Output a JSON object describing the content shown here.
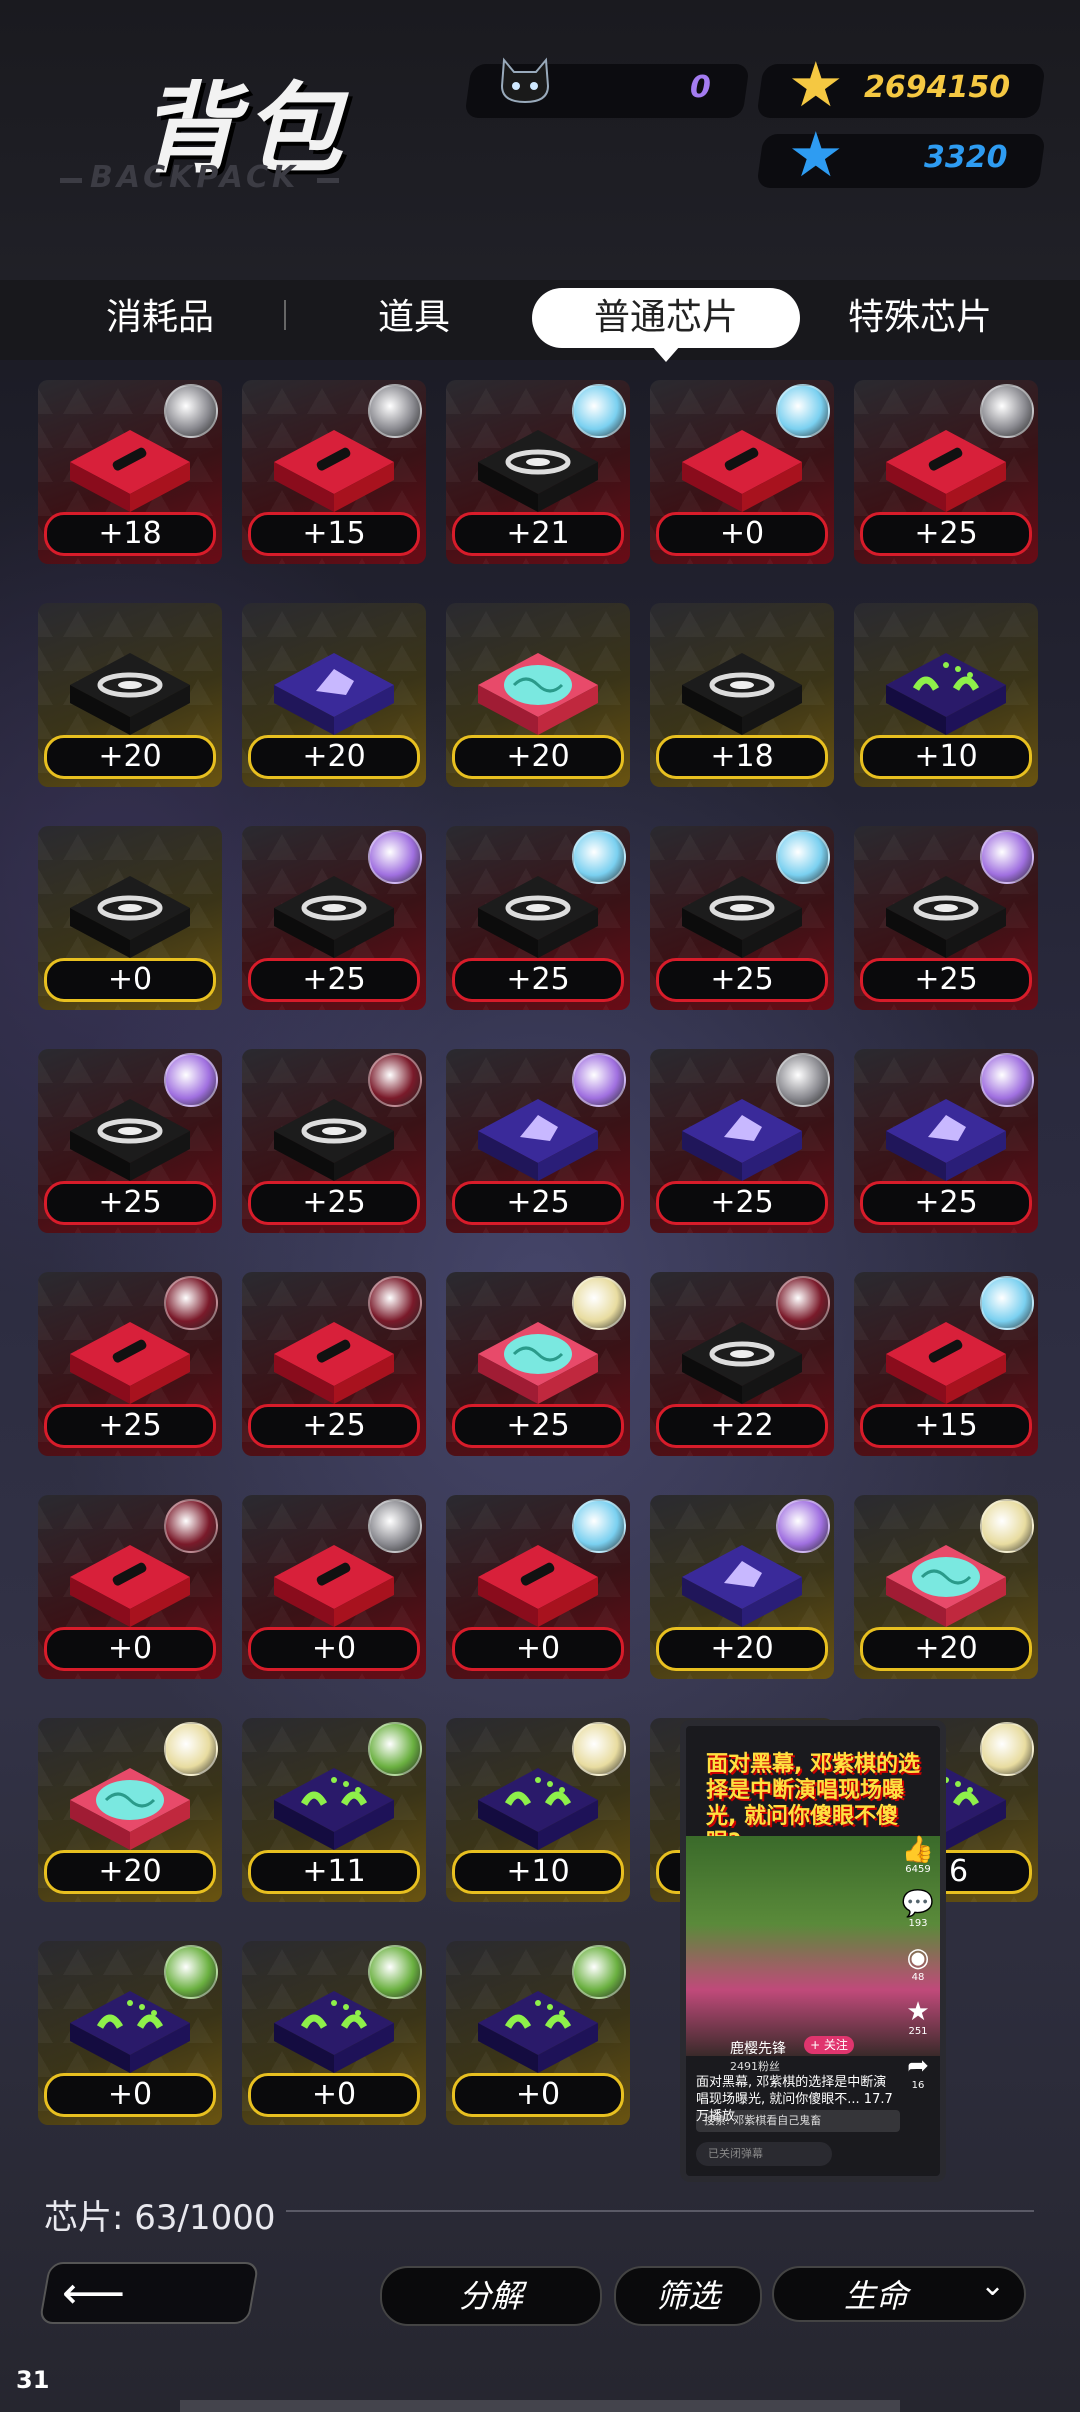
{
  "header": {
    "title": "背包",
    "subtitle": "BACKPACK",
    "currencies": [
      {
        "name": "cat-token",
        "value": "0",
        "color": "#a47cf0"
      },
      {
        "name": "gold-star",
        "value": "2694150",
        "color": "#f5c842"
      },
      {
        "name": "blue-star",
        "value": "3320",
        "color": "#2e9cf2"
      }
    ]
  },
  "tabs": [
    {
      "label": "消耗品",
      "active": false
    },
    {
      "label": "道具",
      "active": false
    },
    {
      "label": "普通芯片",
      "active": true
    },
    {
      "label": "特殊芯片",
      "active": false
    }
  ],
  "chips": [
    {
      "value": "+18",
      "frame": "red",
      "icon": "bullet-icon",
      "badge": "mecha-badge"
    },
    {
      "value": "+15",
      "frame": "red",
      "icon": "bullet-icon",
      "badge": "mecha-badge"
    },
    {
      "value": "+21",
      "frame": "red",
      "icon": "vortex-icon",
      "badge": "ice-badge"
    },
    {
      "value": "+0",
      "frame": "red",
      "icon": "bullet-icon",
      "badge": "ice-badge"
    },
    {
      "value": "+25",
      "frame": "red",
      "icon": "bullet-icon",
      "badge": "mecha-badge"
    },
    {
      "value": "+20",
      "frame": "gold",
      "icon": "vortex-icon",
      "badge": ""
    },
    {
      "value": "+20",
      "frame": "gold",
      "icon": "crest-icon",
      "badge": ""
    },
    {
      "value": "+20",
      "frame": "gold",
      "icon": "brain-icon",
      "badge": ""
    },
    {
      "value": "+18",
      "frame": "gold",
      "icon": "vortex-icon",
      "badge": ""
    },
    {
      "value": "+10",
      "frame": "gold",
      "icon": "wave-icon",
      "badge": ""
    },
    {
      "value": "+0",
      "frame": "gold",
      "icon": "vortex-icon",
      "badge": ""
    },
    {
      "value": "+25",
      "frame": "red",
      "icon": "vortex-icon",
      "badge": "purple-badge"
    },
    {
      "value": "+25",
      "frame": "red",
      "icon": "vortex-icon",
      "badge": "ice-badge"
    },
    {
      "value": "+25",
      "frame": "red",
      "icon": "vortex-icon",
      "badge": "ice-badge"
    },
    {
      "value": "+25",
      "frame": "red",
      "icon": "vortex-icon",
      "badge": "purple-badge"
    },
    {
      "value": "+25",
      "frame": "red",
      "icon": "vortex-icon",
      "badge": "purple-badge"
    },
    {
      "value": "+25",
      "frame": "red",
      "icon": "vortex-icon",
      "badge": "crimson-badge"
    },
    {
      "value": "+25",
      "frame": "red",
      "icon": "crest-icon",
      "badge": "purple-badge"
    },
    {
      "value": "+25",
      "frame": "red",
      "icon": "crest-icon",
      "badge": "mecha-badge"
    },
    {
      "value": "+25",
      "frame": "red",
      "icon": "crest-icon",
      "badge": "purple-badge"
    },
    {
      "value": "+25",
      "frame": "red",
      "icon": "bullet-icon",
      "badge": "crimson-badge"
    },
    {
      "value": "+25",
      "frame": "red",
      "icon": "bullet-icon",
      "badge": "crimson-badge"
    },
    {
      "value": "+25",
      "frame": "red",
      "icon": "brain-icon",
      "badge": "blonde-badge"
    },
    {
      "value": "+22",
      "frame": "red",
      "icon": "vortex-icon",
      "badge": "crimson-badge"
    },
    {
      "value": "+15",
      "frame": "red",
      "icon": "bullet-icon",
      "badge": "ice-badge"
    },
    {
      "value": "+0",
      "frame": "red",
      "icon": "bullet-icon",
      "badge": "crimson-badge"
    },
    {
      "value": "+0",
      "frame": "red",
      "icon": "bullet-icon",
      "badge": "mecha-badge"
    },
    {
      "value": "+0",
      "frame": "red",
      "icon": "bullet-icon",
      "badge": "ice-badge"
    },
    {
      "value": "+20",
      "frame": "gold",
      "icon": "crest-icon",
      "badge": "purple-badge"
    },
    {
      "value": "+20",
      "frame": "gold",
      "icon": "brain-icon",
      "badge": "blonde-badge"
    },
    {
      "value": "+20",
      "frame": "gold",
      "icon": "brain-icon",
      "badge": "blonde-badge"
    },
    {
      "value": "+11",
      "frame": "gold",
      "icon": "wave-icon",
      "badge": "green-badge"
    },
    {
      "value": "+10",
      "frame": "gold",
      "icon": "wave-icon",
      "badge": "blonde-badge"
    },
    {
      "value": "",
      "frame": "gold",
      "icon": "wave-icon",
      "badge": ""
    },
    {
      "value": "+6",
      "frame": "gold",
      "icon": "wave-icon",
      "badge": "blonde-badge"
    },
    {
      "value": "+0",
      "frame": "gold",
      "icon": "wave-icon",
      "badge": "green-badge"
    },
    {
      "value": "+0",
      "frame": "gold",
      "icon": "wave-icon",
      "badge": "green-badge"
    },
    {
      "value": "+0",
      "frame": "gold",
      "icon": "wave-icon",
      "badge": "green-badge"
    }
  ],
  "footer": {
    "count_label": "芯片: 63/1000",
    "decompose_label": "分解",
    "filter_label": "筛选",
    "sort_label": "生命"
  },
  "page_number": "31",
  "video_overlay": {
    "headline": "面对黑幕, 邓紫棋的选择是中断演唱现场曝光, 就问你傻眼不傻眼?",
    "author": "鹿樱先锋",
    "follow": "+ 关注",
    "fans": "2491粉丝",
    "desc": "面对黑幕, 邓紫棋的选择是中断演唱现场曝光, 就问你傻眼不... 17.7万播放",
    "search": "搜索: 邓紫棋看自己鬼畜",
    "comment": "已关闭弹幕",
    "stats": [
      "6459",
      "193",
      "48",
      "251",
      "16"
    ]
  }
}
